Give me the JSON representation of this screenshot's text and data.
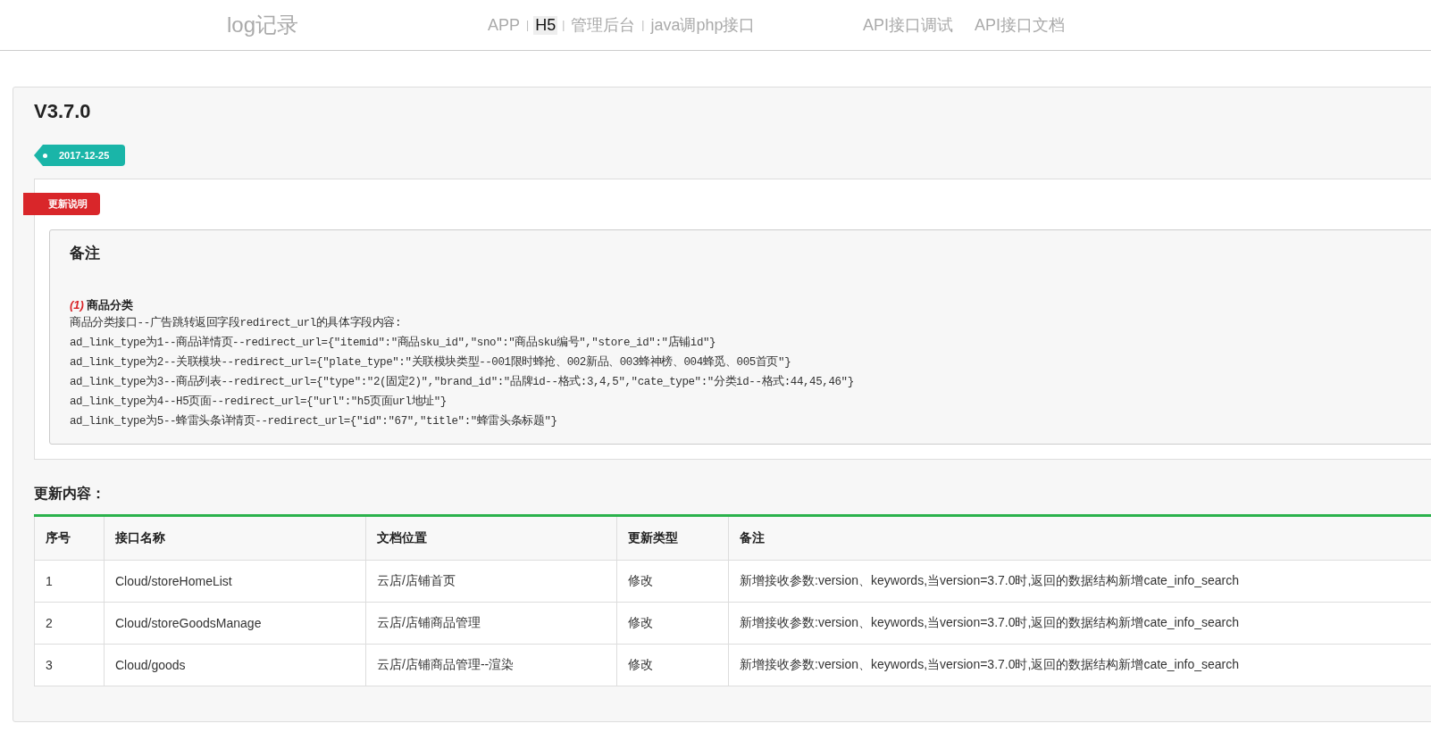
{
  "header": {
    "brand": "log记录",
    "nav": [
      {
        "kind": "link",
        "label": "APP",
        "selected": false
      },
      {
        "kind": "separator",
        "label": "|"
      },
      {
        "kind": "link",
        "label": "H5",
        "selected": true
      },
      {
        "kind": "separator",
        "label": "|"
      },
      {
        "kind": "link",
        "label": "管理后台",
        "selected": false
      },
      {
        "kind": "separator",
        "label": "|"
      },
      {
        "kind": "link",
        "label": "java调php接口",
        "selected": false
      }
    ],
    "api_links": [
      "API接口调试",
      "API接口文档"
    ]
  },
  "version": {
    "title": "V3.7.0",
    "date": "2017-12-25",
    "ribbon": "更新说明",
    "note": {
      "title": "备注",
      "index": "(1)",
      "heading": "商品分类",
      "lines": [
        "商品分类接口--广告跳转返回字段redirect_url的具体字段内容:",
        "ad_link_type为1--商品详情页--redirect_url={\"itemid\":\"商品sku_id\",\"sno\":\"商品sku编号\",\"store_id\":\"店铺id\"}",
        "ad_link_type为2--关联模块--redirect_url={\"plate_type\":\"关联模块类型--001限时蜂抢、002新品、003蜂神榜、004蜂觅、005首页\"}",
        "ad_link_type为3--商品列表--redirect_url={\"type\":\"2(固定2)\",\"brand_id\":\"品牌id--格式:3,4,5\",\"cate_type\":\"分类id--格式:44,45,46\"}",
        "ad_link_type为4--H5页面--redirect_url={\"url\":\"h5页面url地址\"}",
        "ad_link_type为5--蜂雷头条详情页--redirect_url={\"id\":\"67\",\"title\":\"蜂雷头条标题\"}"
      ]
    },
    "changes_title": "更新内容：",
    "table": {
      "columns": [
        "序号",
        "接口名称",
        "文档位置",
        "更新类型",
        "备注"
      ],
      "rows": [
        [
          "1",
          "Cloud/storeHomeList",
          "云店/店铺首页",
          "修改",
          "新增接收参数:version、keywords,当version=3.7.0时,返回的数据结构新增cate_info_search"
        ],
        [
          "2",
          "Cloud/storeGoodsManage",
          "云店/店铺商品管理",
          "修改",
          "新增接收参数:version、keywords,当version=3.7.0时,返回的数据结构新增cate_info_search"
        ],
        [
          "3",
          "Cloud/goods",
          "云店/店铺商品管理--渲染",
          "修改",
          "新增接收参数:version、keywords,当version=3.7.0时,返回的数据结构新增cate_info_search"
        ]
      ]
    }
  }
}
